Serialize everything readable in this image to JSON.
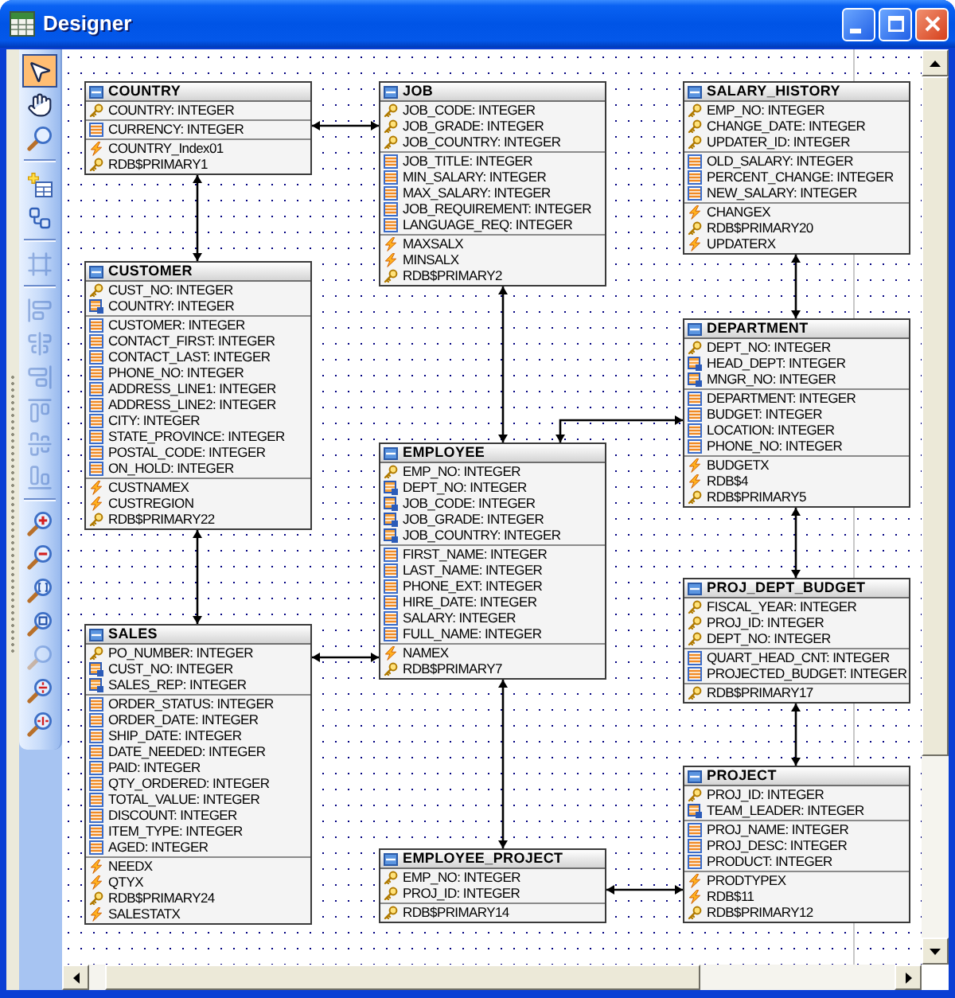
{
  "window": {
    "title": "Designer"
  },
  "toolbar": {
    "groups": [
      [
        {
          "kind": "pointer",
          "selected": true,
          "disabled": false
        },
        {
          "kind": "pan",
          "selected": false,
          "disabled": false
        },
        {
          "kind": "zoom",
          "selected": false,
          "disabled": false
        }
      ],
      [
        {
          "kind": "add_table",
          "selected": false,
          "disabled": false
        },
        {
          "kind": "relation",
          "selected": false,
          "disabled": false
        }
      ],
      [
        {
          "kind": "fit",
          "selected": false,
          "disabled": true
        }
      ],
      [
        {
          "kind": "align_left",
          "selected": false,
          "disabled": true
        },
        {
          "kind": "align_center",
          "selected": false,
          "disabled": true
        },
        {
          "kind": "align_right",
          "selected": false,
          "disabled": true
        },
        {
          "kind": "align_top",
          "selected": false,
          "disabled": true
        },
        {
          "kind": "align_middle",
          "selected": false,
          "disabled": true
        },
        {
          "kind": "align_bottom",
          "selected": false,
          "disabled": true
        }
      ],
      [
        {
          "kind": "zoom_in",
          "selected": false,
          "disabled": false
        },
        {
          "kind": "zoom_out",
          "selected": false,
          "disabled": false
        },
        {
          "kind": "zoom_fit",
          "selected": false,
          "disabled": false
        },
        {
          "kind": "zoom_rect",
          "selected": false,
          "disabled": false
        },
        {
          "kind": "zoom_page",
          "selected": false,
          "disabled": true
        },
        {
          "kind": "zoom_height",
          "selected": false,
          "disabled": false
        },
        {
          "kind": "zoom_width",
          "selected": false,
          "disabled": false
        }
      ]
    ]
  },
  "diagram": {
    "tables": [
      {
        "name": "COUNTRY",
        "sections": [
          {
            "rows": [
              {
                "text": "COUNTRY: INTEGER",
                "kind": "key"
              }
            ]
          },
          {
            "rows": [
              {
                "text": "CURRENCY: INTEGER",
                "kind": "field"
              }
            ]
          },
          {
            "rows": [
              {
                "text": "COUNTRY_Index01",
                "kind": "index"
              },
              {
                "text": "RDB$PRIMARY1",
                "kind": "key"
              }
            ]
          }
        ]
      },
      {
        "name": "JOB",
        "sections": [
          {
            "rows": [
              {
                "text": "JOB_CODE: INTEGER",
                "kind": "key"
              },
              {
                "text": "JOB_GRADE: INTEGER",
                "kind": "key"
              },
              {
                "text": "JOB_COUNTRY: INTEGER",
                "kind": "key"
              }
            ]
          },
          {
            "rows": [
              {
                "text": "JOB_TITLE: INTEGER",
                "kind": "field"
              },
              {
                "text": "MIN_SALARY: INTEGER",
                "kind": "field"
              },
              {
                "text": "MAX_SALARY: INTEGER",
                "kind": "field"
              },
              {
                "text": "JOB_REQUIREMENT: INTEGER",
                "kind": "field"
              },
              {
                "text": "LANGUAGE_REQ: INTEGER",
                "kind": "field"
              }
            ]
          },
          {
            "rows": [
              {
                "text": "MAXSALX",
                "kind": "index"
              },
              {
                "text": "MINSALX",
                "kind": "index"
              },
              {
                "text": "RDB$PRIMARY2",
                "kind": "key"
              }
            ]
          }
        ]
      },
      {
        "name": "SALARY_HISTORY",
        "sections": [
          {
            "rows": [
              {
                "text": "EMP_NO: INTEGER",
                "kind": "key"
              },
              {
                "text": "CHANGE_DATE: INTEGER",
                "kind": "key"
              },
              {
                "text": "UPDATER_ID: INTEGER",
                "kind": "key"
              }
            ]
          },
          {
            "rows": [
              {
                "text": "OLD_SALARY: INTEGER",
                "kind": "field"
              },
              {
                "text": "PERCENT_CHANGE: INTEGER",
                "kind": "field"
              },
              {
                "text": "NEW_SALARY: INTEGER",
                "kind": "field"
              }
            ]
          },
          {
            "rows": [
              {
                "text": "CHANGEX",
                "kind": "index"
              },
              {
                "text": "RDB$PRIMARY20",
                "kind": "key"
              },
              {
                "text": "UPDATERX",
                "kind": "index"
              }
            ]
          }
        ]
      },
      {
        "name": "CUSTOMER",
        "sections": [
          {
            "rows": [
              {
                "text": "CUST_NO: INTEGER",
                "kind": "key"
              },
              {
                "text": "COUNTRY: INTEGER",
                "kind": "foreign_key"
              }
            ]
          },
          {
            "rows": [
              {
                "text": "CUSTOMER: INTEGER",
                "kind": "field"
              },
              {
                "text": "CONTACT_FIRST: INTEGER",
                "kind": "field"
              },
              {
                "text": "CONTACT_LAST: INTEGER",
                "kind": "field"
              },
              {
                "text": "PHONE_NO: INTEGER",
                "kind": "field"
              },
              {
                "text": "ADDRESS_LINE1: INTEGER",
                "kind": "field"
              },
              {
                "text": "ADDRESS_LINE2: INTEGER",
                "kind": "field"
              },
              {
                "text": "CITY: INTEGER",
                "kind": "field"
              },
              {
                "text": "STATE_PROVINCE: INTEGER",
                "kind": "field"
              },
              {
                "text": "POSTAL_CODE: INTEGER",
                "kind": "field"
              },
              {
                "text": "ON_HOLD: INTEGER",
                "kind": "field"
              }
            ]
          },
          {
            "rows": [
              {
                "text": "CUSTNAMEX",
                "kind": "index"
              },
              {
                "text": "CUSTREGION",
                "kind": "index"
              },
              {
                "text": "RDB$PRIMARY22",
                "kind": "key"
              }
            ]
          }
        ]
      },
      {
        "name": "DEPARTMENT",
        "sections": [
          {
            "rows": [
              {
                "text": "DEPT_NO: INTEGER",
                "kind": "key"
              },
              {
                "text": "HEAD_DEPT: INTEGER",
                "kind": "foreign_key"
              },
              {
                "text": "MNGR_NO: INTEGER",
                "kind": "foreign_key"
              }
            ]
          },
          {
            "rows": [
              {
                "text": "DEPARTMENT: INTEGER",
                "kind": "field"
              },
              {
                "text": "BUDGET: INTEGER",
                "kind": "field"
              },
              {
                "text": "LOCATION: INTEGER",
                "kind": "field"
              },
              {
                "text": "PHONE_NO: INTEGER",
                "kind": "field"
              }
            ]
          },
          {
            "rows": [
              {
                "text": "BUDGETX",
                "kind": "index"
              },
              {
                "text": "RDB$4",
                "kind": "index"
              },
              {
                "text": "RDB$PRIMARY5",
                "kind": "key"
              }
            ]
          }
        ]
      },
      {
        "name": "EMPLOYEE",
        "sections": [
          {
            "rows": [
              {
                "text": "EMP_NO: INTEGER",
                "kind": "key"
              },
              {
                "text": "DEPT_NO: INTEGER",
                "kind": "foreign_key"
              },
              {
                "text": "JOB_CODE: INTEGER",
                "kind": "foreign_key"
              },
              {
                "text": "JOB_GRADE: INTEGER",
                "kind": "foreign_key"
              },
              {
                "text": "JOB_COUNTRY: INTEGER",
                "kind": "foreign_key"
              }
            ]
          },
          {
            "rows": [
              {
                "text": "FIRST_NAME: INTEGER",
                "kind": "field"
              },
              {
                "text": "LAST_NAME: INTEGER",
                "kind": "field"
              },
              {
                "text": "PHONE_EXT: INTEGER",
                "kind": "field"
              },
              {
                "text": "HIRE_DATE: INTEGER",
                "kind": "field"
              },
              {
                "text": "SALARY: INTEGER",
                "kind": "field"
              },
              {
                "text": "FULL_NAME: INTEGER",
                "kind": "field"
              }
            ]
          },
          {
            "rows": [
              {
                "text": "NAMEX",
                "kind": "index"
              },
              {
                "text": "RDB$PRIMARY7",
                "kind": "key"
              }
            ]
          }
        ]
      },
      {
        "name": "PROJ_DEPT_BUDGET",
        "sections": [
          {
            "rows": [
              {
                "text": "FISCAL_YEAR: INTEGER",
                "kind": "key"
              },
              {
                "text": "PROJ_ID: INTEGER",
                "kind": "key"
              },
              {
                "text": "DEPT_NO: INTEGER",
                "kind": "key"
              }
            ]
          },
          {
            "rows": [
              {
                "text": "QUART_HEAD_CNT: INTEGER",
                "kind": "field"
              },
              {
                "text": "PROJECTED_BUDGET: INTEGER",
                "kind": "field"
              }
            ]
          },
          {
            "rows": [
              {
                "text": "RDB$PRIMARY17",
                "kind": "key"
              }
            ]
          }
        ]
      },
      {
        "name": "SALES",
        "sections": [
          {
            "rows": [
              {
                "text": "PO_NUMBER: INTEGER",
                "kind": "key"
              },
              {
                "text": "CUST_NO: INTEGER",
                "kind": "foreign_key"
              },
              {
                "text": "SALES_REP: INTEGER",
                "kind": "foreign_key"
              }
            ]
          },
          {
            "rows": [
              {
                "text": "ORDER_STATUS: INTEGER",
                "kind": "field"
              },
              {
                "text": "ORDER_DATE: INTEGER",
                "kind": "field"
              },
              {
                "text": "SHIP_DATE: INTEGER",
                "kind": "field"
              },
              {
                "text": "DATE_NEEDED: INTEGER",
                "kind": "field"
              },
              {
                "text": "PAID: INTEGER",
                "kind": "field"
              },
              {
                "text": "QTY_ORDERED: INTEGER",
                "kind": "field"
              },
              {
                "text": "TOTAL_VALUE: INTEGER",
                "kind": "field"
              },
              {
                "text": "DISCOUNT: INTEGER",
                "kind": "field"
              },
              {
                "text": "ITEM_TYPE: INTEGER",
                "kind": "field"
              },
              {
                "text": "AGED: INTEGER",
                "kind": "field"
              }
            ]
          },
          {
            "rows": [
              {
                "text": "NEEDX",
                "kind": "index"
              },
              {
                "text": "QTYX",
                "kind": "index"
              },
              {
                "text": "RDB$PRIMARY24",
                "kind": "key"
              },
              {
                "text": "SALESTATX",
                "kind": "index"
              }
            ]
          }
        ]
      },
      {
        "name": "EMPLOYEE_PROJECT",
        "sections": [
          {
            "rows": [
              {
                "text": "EMP_NO: INTEGER",
                "kind": "key"
              },
              {
                "text": "PROJ_ID: INTEGER",
                "kind": "key"
              }
            ]
          },
          {
            "rows": [
              {
                "text": "RDB$PRIMARY14",
                "kind": "key"
              }
            ]
          }
        ]
      },
      {
        "name": "PROJECT",
        "sections": [
          {
            "rows": [
              {
                "text": "PROJ_ID: INTEGER",
                "kind": "key"
              },
              {
                "text": "TEAM_LEADER: INTEGER",
                "kind": "foreign_key"
              }
            ]
          },
          {
            "rows": [
              {
                "text": "PROJ_NAME: INTEGER",
                "kind": "field"
              },
              {
                "text": "PROJ_DESC: INTEGER",
                "kind": "field"
              },
              {
                "text": "PRODUCT: INTEGER",
                "kind": "field"
              }
            ]
          },
          {
            "rows": [
              {
                "text": "PRODTYPEX",
                "kind": "index"
              },
              {
                "text": "RDB$11",
                "kind": "index"
              },
              {
                "text": "RDB$PRIMARY12",
                "kind": "key"
              }
            ]
          }
        ]
      }
    ]
  }
}
